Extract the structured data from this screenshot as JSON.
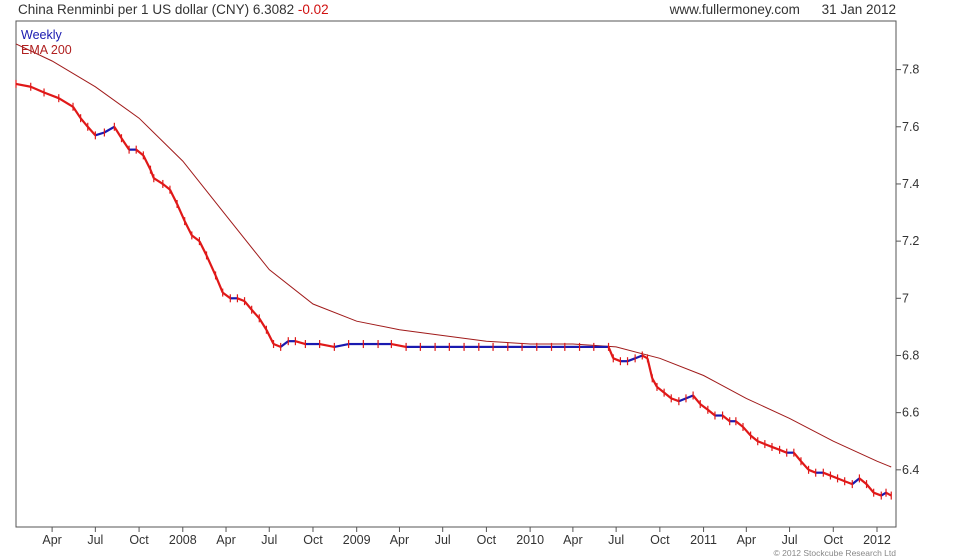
{
  "header": {
    "title": "China Renminbi per 1 US dollar (CNY)",
    "last_value": "6.3082",
    "change": "-0.02",
    "source": "www.fullermoney.com",
    "date": "31 Jan 2012"
  },
  "legend": {
    "period": "Weekly",
    "ema": "EMA 200"
  },
  "copyright": "© 2012 Stockcube Research Ltd",
  "colors": {
    "up": "#1a1ab0",
    "down": "#e01818",
    "ema": "#a01a1a",
    "frame": "#555555"
  },
  "chart_data": {
    "type": "line",
    "ylim": [
      6.2,
      7.97
    ],
    "yticks": [
      6.4,
      6.6,
      6.8,
      7,
      7.2,
      7.4,
      7.6,
      7.8
    ],
    "ytick_labels": [
      "6.4",
      "6.6",
      "6.8",
      "7",
      "7.2",
      "7.4",
      "7.6",
      "7.8"
    ],
    "x_start": "2007-01-15",
    "x_end": "2012-02-10",
    "xticks": [
      {
        "date": "2007-04-01",
        "label": "Apr"
      },
      {
        "date": "2007-07-01",
        "label": "Jul"
      },
      {
        "date": "2007-10-01",
        "label": "Oct"
      },
      {
        "date": "2008-01-01",
        "label": "2008"
      },
      {
        "date": "2008-04-01",
        "label": "Apr"
      },
      {
        "date": "2008-07-01",
        "label": "Jul"
      },
      {
        "date": "2008-10-01",
        "label": "Oct"
      },
      {
        "date": "2009-01-01",
        "label": "2009"
      },
      {
        "date": "2009-04-01",
        "label": "Apr"
      },
      {
        "date": "2009-07-01",
        "label": "Jul"
      },
      {
        "date": "2009-10-01",
        "label": "Oct"
      },
      {
        "date": "2010-01-01",
        "label": "2010"
      },
      {
        "date": "2010-04-01",
        "label": "Apr"
      },
      {
        "date": "2010-07-01",
        "label": "Jul"
      },
      {
        "date": "2010-10-01",
        "label": "Oct"
      },
      {
        "date": "2011-01-01",
        "label": "2011"
      },
      {
        "date": "2011-04-01",
        "label": "Apr"
      },
      {
        "date": "2011-07-01",
        "label": "Jul"
      },
      {
        "date": "2011-10-01",
        "label": "Oct"
      },
      {
        "date": "2012-01-01",
        "label": "2012"
      }
    ],
    "series": [
      {
        "name": "Weekly",
        "style": "price",
        "points": [
          [
            "2007-01-15",
            7.75
          ],
          [
            "2007-02-15",
            7.74
          ],
          [
            "2007-03-15",
            7.72
          ],
          [
            "2007-04-15",
            7.7
          ],
          [
            "2007-05-15",
            7.67
          ],
          [
            "2007-05-31",
            7.63
          ],
          [
            "2007-06-15",
            7.6
          ],
          [
            "2007-07-01",
            7.57
          ],
          [
            "2007-07-20",
            7.58
          ],
          [
            "2007-08-10",
            7.6
          ],
          [
            "2007-08-25",
            7.56
          ],
          [
            "2007-09-10",
            7.52
          ],
          [
            "2007-09-25",
            7.52
          ],
          [
            "2007-10-10",
            7.5
          ],
          [
            "2007-10-25",
            7.45
          ],
          [
            "2007-11-01",
            7.42
          ],
          [
            "2007-11-20",
            7.4
          ],
          [
            "2007-12-05",
            7.38
          ],
          [
            "2007-12-20",
            7.33
          ],
          [
            "2008-01-05",
            7.27
          ],
          [
            "2008-01-20",
            7.22
          ],
          [
            "2008-02-05",
            7.2
          ],
          [
            "2008-02-20",
            7.15
          ],
          [
            "2008-03-10",
            7.08
          ],
          [
            "2008-03-25",
            7.02
          ],
          [
            "2008-04-10",
            7.0
          ],
          [
            "2008-04-25",
            7.0
          ],
          [
            "2008-05-10",
            6.99
          ],
          [
            "2008-05-25",
            6.96
          ],
          [
            "2008-06-10",
            6.93
          ],
          [
            "2008-06-25",
            6.89
          ],
          [
            "2008-07-10",
            6.84
          ],
          [
            "2008-07-25",
            6.83
          ],
          [
            "2008-08-10",
            6.85
          ],
          [
            "2008-08-25",
            6.85
          ],
          [
            "2008-09-15",
            6.84
          ],
          [
            "2008-10-15",
            6.84
          ],
          [
            "2008-11-15",
            6.83
          ],
          [
            "2008-12-15",
            6.84
          ],
          [
            "2009-01-15",
            6.84
          ],
          [
            "2009-02-15",
            6.84
          ],
          [
            "2009-03-15",
            6.84
          ],
          [
            "2009-04-15",
            6.83
          ],
          [
            "2009-05-15",
            6.83
          ],
          [
            "2009-06-15",
            6.83
          ],
          [
            "2009-07-15",
            6.83
          ],
          [
            "2009-08-15",
            6.83
          ],
          [
            "2009-09-15",
            6.83
          ],
          [
            "2009-10-15",
            6.83
          ],
          [
            "2009-11-15",
            6.83
          ],
          [
            "2009-12-15",
            6.83
          ],
          [
            "2010-01-15",
            6.83
          ],
          [
            "2010-02-15",
            6.83
          ],
          [
            "2010-03-15",
            6.83
          ],
          [
            "2010-04-15",
            6.83
          ],
          [
            "2010-05-15",
            6.83
          ],
          [
            "2010-06-15",
            6.83
          ],
          [
            "2010-06-25",
            6.79
          ],
          [
            "2010-07-10",
            6.78
          ],
          [
            "2010-07-25",
            6.78
          ],
          [
            "2010-08-10",
            6.79
          ],
          [
            "2010-08-25",
            6.8
          ],
          [
            "2010-09-05",
            6.79
          ],
          [
            "2010-09-15",
            6.72
          ],
          [
            "2010-09-25",
            6.69
          ],
          [
            "2010-10-10",
            6.67
          ],
          [
            "2010-10-25",
            6.65
          ],
          [
            "2010-11-10",
            6.64
          ],
          [
            "2010-11-25",
            6.65
          ],
          [
            "2010-12-10",
            6.66
          ],
          [
            "2010-12-25",
            6.63
          ],
          [
            "2011-01-10",
            6.61
          ],
          [
            "2011-01-25",
            6.59
          ],
          [
            "2011-02-10",
            6.59
          ],
          [
            "2011-02-25",
            6.57
          ],
          [
            "2011-03-10",
            6.57
          ],
          [
            "2011-03-25",
            6.55
          ],
          [
            "2011-04-10",
            6.52
          ],
          [
            "2011-04-25",
            6.5
          ],
          [
            "2011-05-10",
            6.49
          ],
          [
            "2011-05-25",
            6.48
          ],
          [
            "2011-06-10",
            6.47
          ],
          [
            "2011-06-25",
            6.46
          ],
          [
            "2011-07-10",
            6.46
          ],
          [
            "2011-07-25",
            6.43
          ],
          [
            "2011-08-10",
            6.4
          ],
          [
            "2011-08-25",
            6.39
          ],
          [
            "2011-09-10",
            6.39
          ],
          [
            "2011-09-25",
            6.38
          ],
          [
            "2011-10-10",
            6.37
          ],
          [
            "2011-10-25",
            6.36
          ],
          [
            "2011-11-10",
            6.35
          ],
          [
            "2011-11-25",
            6.37
          ],
          [
            "2011-12-10",
            6.35
          ],
          [
            "2011-12-25",
            6.32
          ],
          [
            "2012-01-10",
            6.31
          ],
          [
            "2012-01-20",
            6.32
          ],
          [
            "2012-01-31",
            6.31
          ]
        ]
      },
      {
        "name": "EMA 200",
        "style": "ema",
        "points": [
          [
            "2007-01-15",
            7.89
          ],
          [
            "2007-04-01",
            7.83
          ],
          [
            "2007-07-01",
            7.74
          ],
          [
            "2007-10-01",
            7.63
          ],
          [
            "2008-01-01",
            7.48
          ],
          [
            "2008-04-01",
            7.29
          ],
          [
            "2008-07-01",
            7.1
          ],
          [
            "2008-10-01",
            6.98
          ],
          [
            "2009-01-01",
            6.92
          ],
          [
            "2009-04-01",
            6.89
          ],
          [
            "2009-07-01",
            6.87
          ],
          [
            "2009-10-01",
            6.85
          ],
          [
            "2010-01-01",
            6.84
          ],
          [
            "2010-04-01",
            6.84
          ],
          [
            "2010-07-01",
            6.83
          ],
          [
            "2010-10-01",
            6.79
          ],
          [
            "2011-01-01",
            6.73
          ],
          [
            "2011-04-01",
            6.65
          ],
          [
            "2011-07-01",
            6.58
          ],
          [
            "2011-10-01",
            6.5
          ],
          [
            "2012-01-01",
            6.43
          ],
          [
            "2012-01-31",
            6.41
          ]
        ]
      }
    ]
  }
}
